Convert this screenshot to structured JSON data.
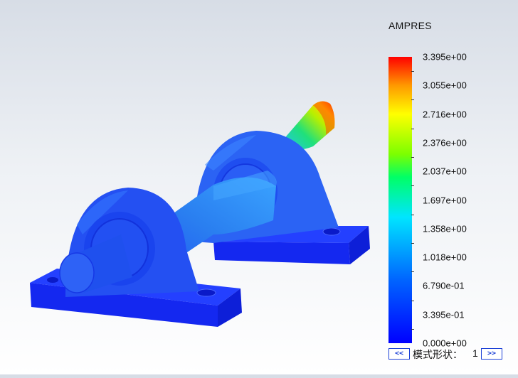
{
  "legend": {
    "title": "AMPRES",
    "ticks": [
      "3.395e+00",
      "3.055e+00",
      "2.716e+00",
      "2.376e+00",
      "2.037e+00",
      "1.697e+00",
      "1.358e+00",
      "1.018e+00",
      "6.790e-01",
      "3.395e-01",
      "0.000e+00"
    ]
  },
  "mode": {
    "prev_label": "<<",
    "label": "模式形状：",
    "number": "1",
    "next_label": ">>"
  },
  "colors": {
    "low": "#0000ff",
    "high": "#ff0000"
  }
}
